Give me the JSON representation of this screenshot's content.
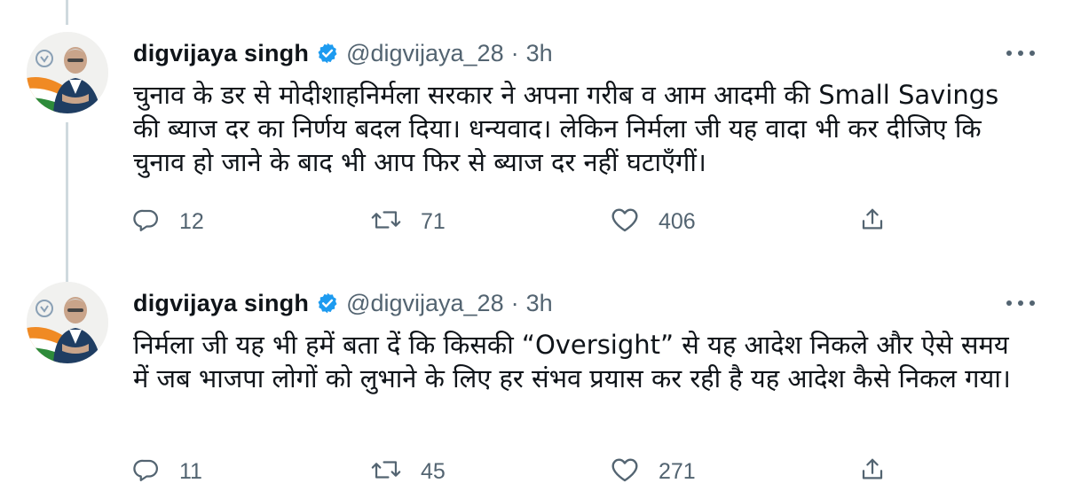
{
  "tweets": [
    {
      "author": "digvijaya singh",
      "handle": "@digvijaya_28",
      "separator": "·",
      "time": "3h",
      "text": "चुनाव के डर से मोदीशाहनिर्मला सरकार ने अपना गरीब व आम आदमी की Small Savings की ब्याज दर का निर्णय बदल दिया। धन्यवाद। लेकिन निर्मला जी यह वादा भी कर दीजिए कि चुनाव हो जाने के बाद भी आप फिर से ब्याज दर नहीं घटाएँगीं।",
      "replies": "12",
      "retweets": "71",
      "likes": "406"
    },
    {
      "author": "digvijaya singh",
      "handle": "@digvijaya_28",
      "separator": "·",
      "time": "3h",
      "text": "निर्मला जी यह भी हमें बता दें कि किसकी “Oversight” से यह आदेश निकले और ऐसे समय में जब भाजपा लोगों को लुभाने के लिए हर संभव प्रयास कर रही है यह आदेश कैसे निकल गया।",
      "replies": "11",
      "retweets": "45",
      "likes": "271"
    }
  ],
  "icons": {
    "verified": "verified-badge-icon",
    "more": "more-options-icon",
    "reply": "reply-icon",
    "retweet": "retweet-icon",
    "like": "like-icon",
    "share": "share-icon"
  },
  "colors": {
    "verified_blue": "#1d9bf0",
    "text_primary": "#0f1419",
    "text_secondary": "#536471",
    "thread_line": "#cfd9de"
  }
}
